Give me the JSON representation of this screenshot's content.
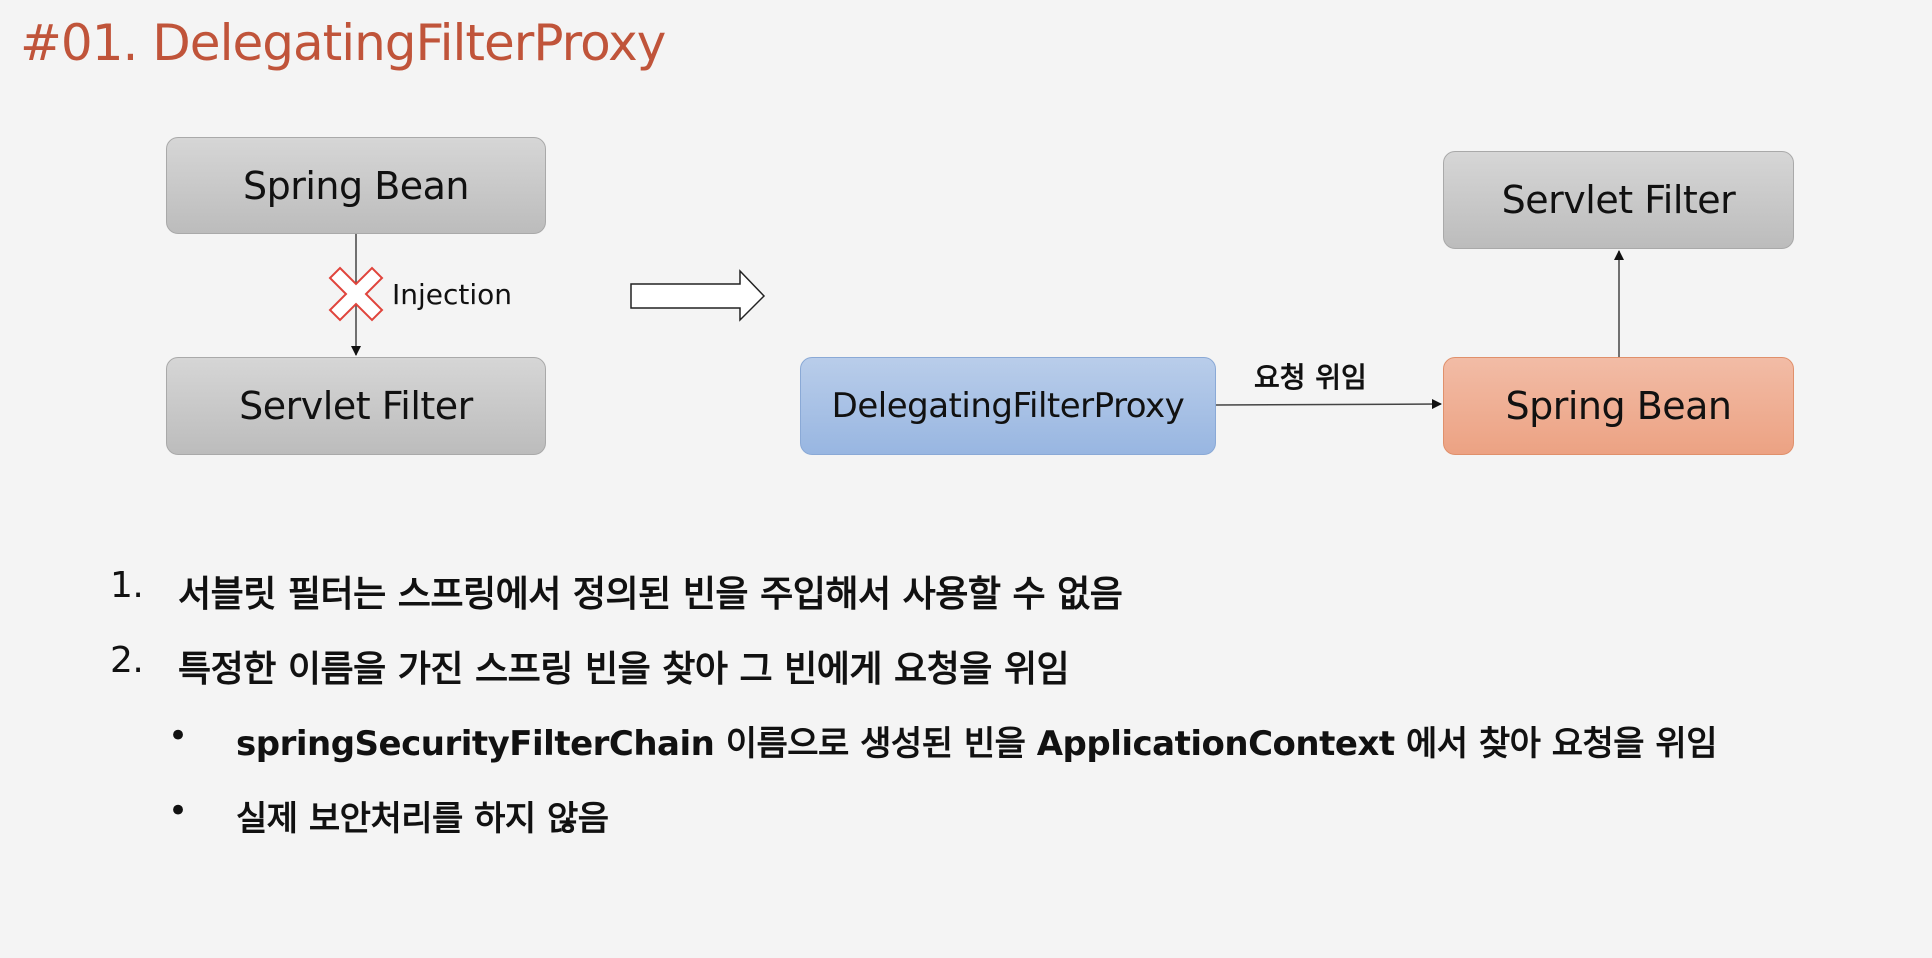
{
  "title": "#01. DelegatingFilterProxy",
  "left_diagram": {
    "top_box": "Spring Bean",
    "bottom_box": "Servlet Filter",
    "edge_label": "Injection",
    "edge_status": "blocked"
  },
  "right_diagram": {
    "proxy_box": "DelegatingFilterProxy",
    "bean_box": "Spring Bean",
    "filter_box": "Servlet Filter",
    "edge_label": "요청 위임"
  },
  "colors": {
    "title": "#c0543a",
    "gray_box": "#c8c8c8",
    "proxy_box": "#a8c1e6",
    "bean_box": "#eeae92",
    "cross": "#e0443c"
  },
  "list": [
    {
      "marker": "1.",
      "text": "서블릿 필터는 스프링에서 정의된 빈을 주입해서 사용할 수 없음"
    },
    {
      "marker": "2.",
      "text": "특정한 이름을 가진 스프링 빈을 찾아 그 빈에게 요청을 위임"
    },
    {
      "marker": "•",
      "text": "springSecurityFilterChain 이름으로 생성된 빈을 ApplicationContext 에서 찾아 요청을 위임"
    },
    {
      "marker": "•",
      "text": "실제 보안처리를 하지 않음"
    }
  ]
}
